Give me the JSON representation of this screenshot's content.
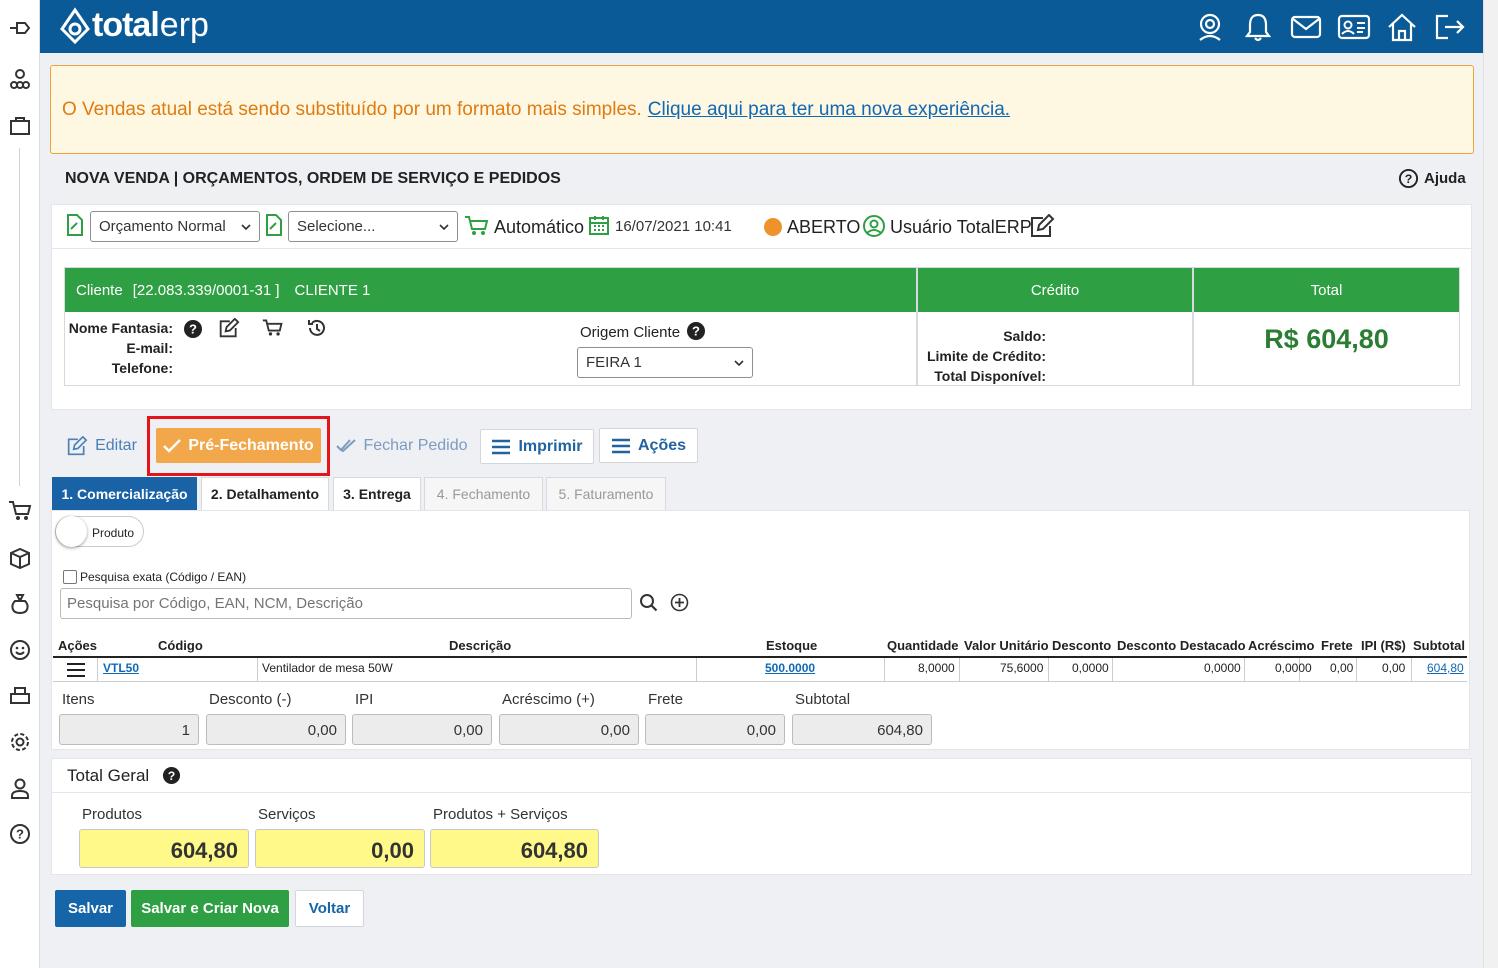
{
  "sidebar": {
    "icons": [
      "pin-icon",
      "org-icon",
      "bag-icon",
      "cart-icon",
      "box-icon",
      "money-bag-icon",
      "smile-icon",
      "printer-icon",
      "gear-icon",
      "user-icon",
      "help-icon"
    ]
  },
  "topbar": {
    "logo_bold": "total",
    "logo_light": "erp",
    "icons": [
      "support-icon",
      "bell-icon",
      "mail-icon",
      "id-card-icon",
      "home-icon",
      "logout-icon"
    ]
  },
  "banner": {
    "text": "O Vendas atual está sendo substituído por um formato mais simples.",
    "link": "Clique aqui para ter uma nova experiência."
  },
  "page": {
    "title": "NOVA VENDA | ORÇAMENTOS, ORDEM DE SERVIÇO E PEDIDOS",
    "help": "Ajuda"
  },
  "order": {
    "type": "Orçamento Normal",
    "select2": "Selecione...",
    "mode": "Automático",
    "datetime": "16/07/2021 10:41",
    "status": "ABERTO",
    "status_color": "#f0922b",
    "user": "Usuário TotalERP"
  },
  "client": {
    "label": "Cliente",
    "doc": "[22.083.339/0001-31 ]",
    "name": "CLIENTE 1",
    "nome_fantasia": "Nome Fantasia:",
    "email": "E-mail:",
    "telefone": "Telefone:",
    "origem_label": "Origem Cliente",
    "origem": "FEIRA 1"
  },
  "credito": {
    "title": "Crédito",
    "saldo": "Saldo:",
    "limite": "Limite de Crédito:",
    "disponivel": "Total Disponível:"
  },
  "total": {
    "title": "Total",
    "value": "R$ 604,80"
  },
  "actions": {
    "editar": "Editar",
    "pre": "Pré-Fechamento",
    "fechar": "Fechar Pedido",
    "imprimir": "Imprimir",
    "acoes": "Ações"
  },
  "tabs": [
    "1. Comercialização",
    "2. Detalhamento",
    "3. Entrega",
    "4. Fechamento",
    "5. Faturamento"
  ],
  "search": {
    "toggle": "Produto",
    "exact": "Pesquisa exata (Código / EAN)",
    "placeholder": "Pesquisa por Código, EAN, NCM, Descrição"
  },
  "table": {
    "headers": [
      "Ações",
      "Código",
      "Descrição",
      "Estoque",
      "Quantidade",
      "Valor Unitário",
      "Desconto",
      "Desconto Destacado",
      "Acréscimo",
      "Frete",
      "IPI (R$)",
      "Subtotal"
    ],
    "row": {
      "codigo": "VTL50",
      "descricao": "Ventilador de mesa 50W",
      "estoque": "500.0000",
      "quantidade": "8,0000",
      "valor": "75,6000",
      "desconto": "0,0000",
      "desc_dest": "0,0000",
      "acrescimo": "0,0000",
      "frete": "0,00",
      "ipi": "0,00",
      "subtotal": "604,80"
    }
  },
  "summary": {
    "labels": [
      "Itens",
      "Desconto (-)",
      "IPI",
      "Acréscimo (+)",
      "Frete",
      "Subtotal"
    ],
    "values": [
      "1",
      "0,00",
      "0,00",
      "0,00",
      "0,00",
      "604,80"
    ]
  },
  "total_geral": {
    "title": "Total Geral",
    "produtos_label": "Produtos",
    "produtos": "604,80",
    "servicos_label": "Serviços",
    "servicos": "0,00",
    "ps_label": "Produtos + Serviços",
    "ps": "604,80"
  },
  "footer": {
    "salvar": "Salvar",
    "salvar_nova": "Salvar e Criar Nova",
    "voltar": "Voltar"
  }
}
